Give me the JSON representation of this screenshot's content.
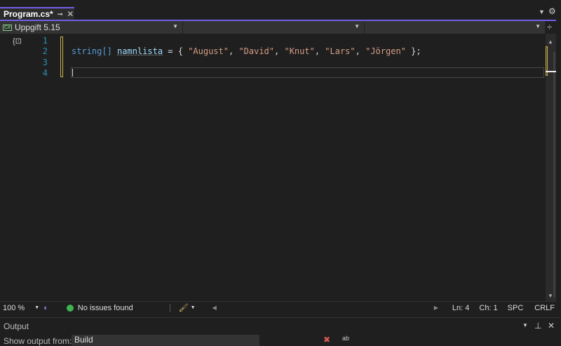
{
  "tab": {
    "title": "Program.cs*"
  },
  "nav": {
    "project": "Uppgift 5.15"
  },
  "editor": {
    "line_numbers": [
      "1",
      "2",
      "3",
      "4"
    ],
    "line2": {
      "type": "string[]",
      "name": "namnlista",
      "eq": " = { ",
      "s1": "\"August\"",
      "s2": "\"David\"",
      "s3": "\"Knut\"",
      "s4": "\"Lars\"",
      "s5": "\"Jörgen\"",
      "sep": ", ",
      "end": " };"
    }
  },
  "status": {
    "zoom": "100 %",
    "issues": "No issues found",
    "ln": "Ln: 4",
    "ch": "Ch: 1",
    "spc": "SPC",
    "crlf": "CRLF"
  },
  "output": {
    "title": "Output",
    "show_from": "Show output from:",
    "source": "Build"
  }
}
